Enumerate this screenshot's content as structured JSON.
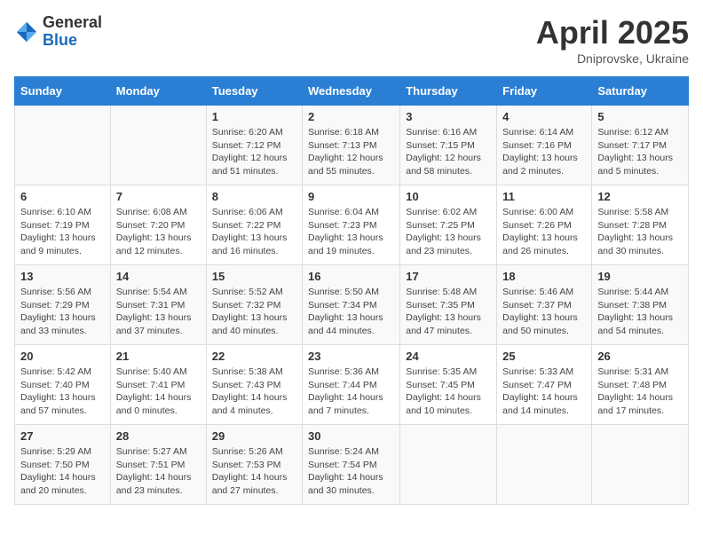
{
  "logo": {
    "general": "General",
    "blue": "Blue"
  },
  "title": "April 2025",
  "subtitle": "Dniprovske, Ukraine",
  "days_header": [
    "Sunday",
    "Monday",
    "Tuesday",
    "Wednesday",
    "Thursday",
    "Friday",
    "Saturday"
  ],
  "weeks": [
    [
      {
        "day": "",
        "info": ""
      },
      {
        "day": "",
        "info": ""
      },
      {
        "day": "1",
        "info": "Sunrise: 6:20 AM\nSunset: 7:12 PM\nDaylight: 12 hours and 51 minutes."
      },
      {
        "day": "2",
        "info": "Sunrise: 6:18 AM\nSunset: 7:13 PM\nDaylight: 12 hours and 55 minutes."
      },
      {
        "day": "3",
        "info": "Sunrise: 6:16 AM\nSunset: 7:15 PM\nDaylight: 12 hours and 58 minutes."
      },
      {
        "day": "4",
        "info": "Sunrise: 6:14 AM\nSunset: 7:16 PM\nDaylight: 13 hours and 2 minutes."
      },
      {
        "day": "5",
        "info": "Sunrise: 6:12 AM\nSunset: 7:17 PM\nDaylight: 13 hours and 5 minutes."
      }
    ],
    [
      {
        "day": "6",
        "info": "Sunrise: 6:10 AM\nSunset: 7:19 PM\nDaylight: 13 hours and 9 minutes."
      },
      {
        "day": "7",
        "info": "Sunrise: 6:08 AM\nSunset: 7:20 PM\nDaylight: 13 hours and 12 minutes."
      },
      {
        "day": "8",
        "info": "Sunrise: 6:06 AM\nSunset: 7:22 PM\nDaylight: 13 hours and 16 minutes."
      },
      {
        "day": "9",
        "info": "Sunrise: 6:04 AM\nSunset: 7:23 PM\nDaylight: 13 hours and 19 minutes."
      },
      {
        "day": "10",
        "info": "Sunrise: 6:02 AM\nSunset: 7:25 PM\nDaylight: 13 hours and 23 minutes."
      },
      {
        "day": "11",
        "info": "Sunrise: 6:00 AM\nSunset: 7:26 PM\nDaylight: 13 hours and 26 minutes."
      },
      {
        "day": "12",
        "info": "Sunrise: 5:58 AM\nSunset: 7:28 PM\nDaylight: 13 hours and 30 minutes."
      }
    ],
    [
      {
        "day": "13",
        "info": "Sunrise: 5:56 AM\nSunset: 7:29 PM\nDaylight: 13 hours and 33 minutes."
      },
      {
        "day": "14",
        "info": "Sunrise: 5:54 AM\nSunset: 7:31 PM\nDaylight: 13 hours and 37 minutes."
      },
      {
        "day": "15",
        "info": "Sunrise: 5:52 AM\nSunset: 7:32 PM\nDaylight: 13 hours and 40 minutes."
      },
      {
        "day": "16",
        "info": "Sunrise: 5:50 AM\nSunset: 7:34 PM\nDaylight: 13 hours and 44 minutes."
      },
      {
        "day": "17",
        "info": "Sunrise: 5:48 AM\nSunset: 7:35 PM\nDaylight: 13 hours and 47 minutes."
      },
      {
        "day": "18",
        "info": "Sunrise: 5:46 AM\nSunset: 7:37 PM\nDaylight: 13 hours and 50 minutes."
      },
      {
        "day": "19",
        "info": "Sunrise: 5:44 AM\nSunset: 7:38 PM\nDaylight: 13 hours and 54 minutes."
      }
    ],
    [
      {
        "day": "20",
        "info": "Sunrise: 5:42 AM\nSunset: 7:40 PM\nDaylight: 13 hours and 57 minutes."
      },
      {
        "day": "21",
        "info": "Sunrise: 5:40 AM\nSunset: 7:41 PM\nDaylight: 14 hours and 0 minutes."
      },
      {
        "day": "22",
        "info": "Sunrise: 5:38 AM\nSunset: 7:43 PM\nDaylight: 14 hours and 4 minutes."
      },
      {
        "day": "23",
        "info": "Sunrise: 5:36 AM\nSunset: 7:44 PM\nDaylight: 14 hours and 7 minutes."
      },
      {
        "day": "24",
        "info": "Sunrise: 5:35 AM\nSunset: 7:45 PM\nDaylight: 14 hours and 10 minutes."
      },
      {
        "day": "25",
        "info": "Sunrise: 5:33 AM\nSunset: 7:47 PM\nDaylight: 14 hours and 14 minutes."
      },
      {
        "day": "26",
        "info": "Sunrise: 5:31 AM\nSunset: 7:48 PM\nDaylight: 14 hours and 17 minutes."
      }
    ],
    [
      {
        "day": "27",
        "info": "Sunrise: 5:29 AM\nSunset: 7:50 PM\nDaylight: 14 hours and 20 minutes."
      },
      {
        "day": "28",
        "info": "Sunrise: 5:27 AM\nSunset: 7:51 PM\nDaylight: 14 hours and 23 minutes."
      },
      {
        "day": "29",
        "info": "Sunrise: 5:26 AM\nSunset: 7:53 PM\nDaylight: 14 hours and 27 minutes."
      },
      {
        "day": "30",
        "info": "Sunrise: 5:24 AM\nSunset: 7:54 PM\nDaylight: 14 hours and 30 minutes."
      },
      {
        "day": "",
        "info": ""
      },
      {
        "day": "",
        "info": ""
      },
      {
        "day": "",
        "info": ""
      }
    ]
  ]
}
